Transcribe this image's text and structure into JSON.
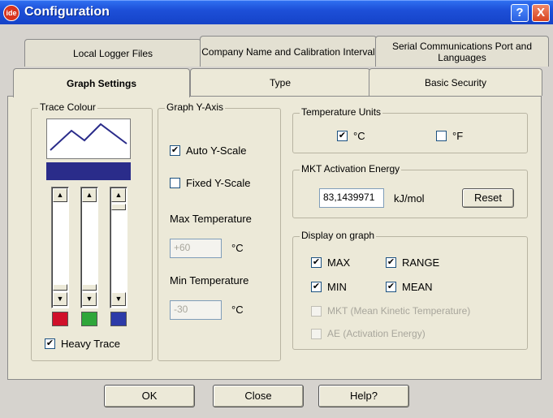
{
  "window": {
    "title": "Configuration",
    "app_icon_text": "ide",
    "help_glyph": "?",
    "close_glyph": "X"
  },
  "tabs": {
    "back_row": [
      "Local Logger Files",
      "Company Name and Calibration Interval",
      "Serial Communications Port and Languages"
    ],
    "front_row": [
      "Graph Settings",
      "Type",
      "Basic Security"
    ],
    "active": "Graph Settings"
  },
  "trace_colour": {
    "legend": "Trace Colour",
    "swatch_colors": [
      "#d0102a",
      "#2fa63a",
      "#2c3aa8"
    ],
    "bar_color": "#2a2c8a",
    "heavy_trace_label": "Heavy Trace",
    "heavy_trace_checked": true
  },
  "graph_y_axis": {
    "legend": "Graph Y-Axis",
    "auto_y_scale_label": "Auto Y-Scale",
    "auto_y_scale_checked": true,
    "fixed_y_scale_label": "Fixed Y-Scale",
    "fixed_y_scale_checked": false,
    "max_temperature_label": "Max Temperature",
    "max_temperature_value": "+60",
    "min_temperature_label": "Min Temperature",
    "min_temperature_value": "-30",
    "unit": "°C"
  },
  "temperature_units": {
    "legend": "Temperature Units",
    "celsius_label": "°C",
    "celsius_checked": true,
    "fahrenheit_label": "°F",
    "fahrenheit_checked": false
  },
  "mkt_activation": {
    "legend": "MKT Activation Energy",
    "value": "83,1439971",
    "unit": "kJ/mol",
    "reset_label": "Reset"
  },
  "display_on_graph": {
    "legend": "Display on graph",
    "max_label": "MAX",
    "max_checked": true,
    "range_label": "RANGE",
    "range_checked": true,
    "min_label": "MIN",
    "min_checked": true,
    "mean_label": "MEAN",
    "mean_checked": true,
    "mkt_label": "MKT (Mean Kinetic Temperature)",
    "mkt_checked": false,
    "ae_label": "AE (Activation Energy)",
    "ae_checked": false
  },
  "buttons": {
    "ok": "OK",
    "close": "Close",
    "help": "Help?"
  },
  "check_glyph": "✔"
}
